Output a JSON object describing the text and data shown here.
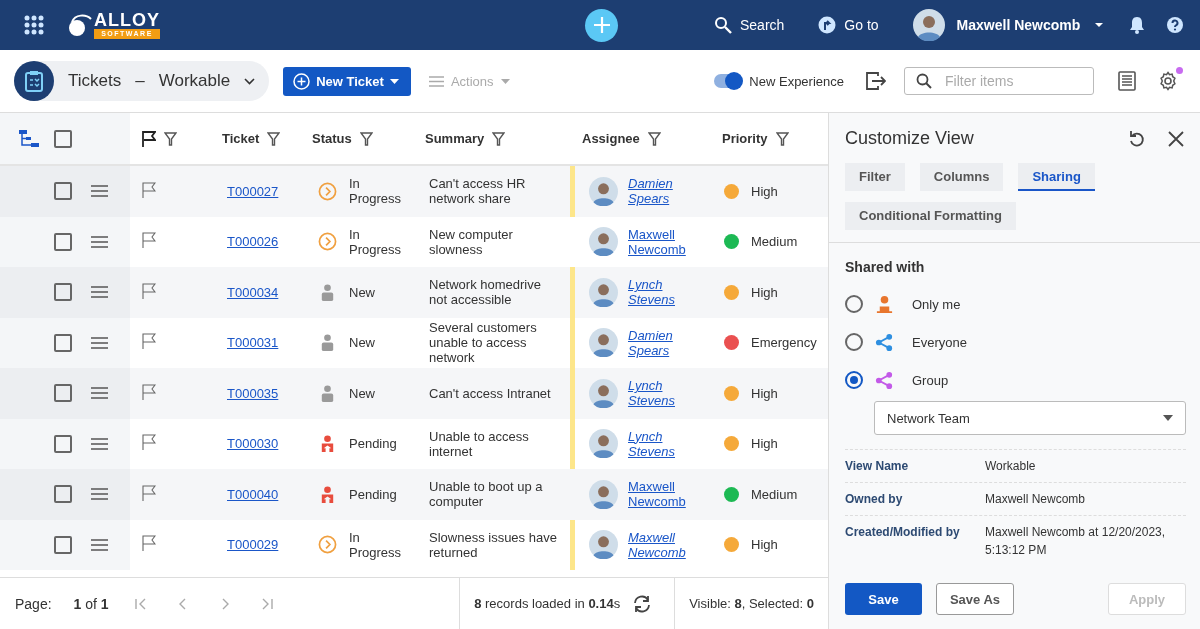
{
  "topbar": {
    "logo": {
      "name": "ALLOY",
      "tagline": "SOFTWARE"
    },
    "search": "Search",
    "goto": "Go to",
    "user": "Maxwell Newcomb"
  },
  "toolbar": {
    "module": "Tickets",
    "separator": "–",
    "view": "Workable",
    "new_button": "New Ticket",
    "actions": {
      "label": "Actions",
      "disabled": true
    },
    "toggle": {
      "label": "New Experience",
      "on": true
    },
    "filter": {
      "placeholder": "Filter items"
    },
    "settings_notification": true
  },
  "table": {
    "select_all": false,
    "columns": [
      "Ticket",
      "Status",
      "Summary",
      "Assignee",
      "Priority"
    ],
    "rows": [
      {
        "checked": false,
        "ticket": "T000027",
        "status": "In Progress",
        "kind": "in_progress",
        "summary": "Can't access HR network share",
        "assignee": "Damien Spears",
        "highlighted": true,
        "priority": "High",
        "color": "#f5a93a"
      },
      {
        "checked": false,
        "ticket": "T000026",
        "status": "In Progress",
        "kind": "in_progress",
        "summary": "New computer slowness",
        "assignee": "Maxwell Newcomb",
        "highlighted": false,
        "priority": "Medium",
        "color": "#1db954"
      },
      {
        "checked": false,
        "ticket": "T000034",
        "status": "New",
        "kind": "new",
        "summary": "Network homedrive not accessible",
        "assignee": "Lynch Stevens",
        "highlighted": true,
        "priority": "High",
        "color": "#f5a93a"
      },
      {
        "checked": false,
        "ticket": "T000031",
        "status": "New",
        "kind": "new",
        "summary": "Several customers unable to access network",
        "assignee": "Damien Spears",
        "highlighted": true,
        "priority": "Emergency",
        "color": "#ea5050"
      },
      {
        "checked": false,
        "ticket": "T000035",
        "status": "New",
        "kind": "new",
        "summary": "Can't access Intranet",
        "assignee": "Lynch Stevens",
        "highlighted": true,
        "priority": "High",
        "color": "#f5a93a"
      },
      {
        "checked": false,
        "ticket": "T000030",
        "status": "Pending",
        "kind": "pending",
        "summary": "Unable to access internet",
        "assignee": "Lynch Stevens",
        "highlighted": true,
        "priority": "High",
        "color": "#f5a93a"
      },
      {
        "checked": false,
        "ticket": "T000040",
        "status": "Pending",
        "kind": "pending",
        "summary": "Unable to boot up a computer",
        "assignee": "Maxwell Newcomb",
        "highlighted": false,
        "priority": "Medium",
        "color": "#1db954"
      },
      {
        "checked": false,
        "ticket": "T000029",
        "status": "In Progress",
        "kind": "in_progress",
        "summary": "Slowness issues have returned",
        "assignee": "Maxwell Newcomb",
        "highlighted": true,
        "priority": "High",
        "color": "#f5a93a"
      }
    ]
  },
  "footer": {
    "page_label": "Page:",
    "page": "**1** of **1**",
    "records": "**8** records loaded in **0.14**s",
    "counts": "Visible: **8**, Selected: **0**"
  },
  "panel": {
    "title": "Customize View",
    "tabs": [
      {
        "label": "Filter",
        "selected": false
      },
      {
        "label": "Columns",
        "selected": false
      },
      {
        "label": "Sharing",
        "selected": true
      },
      {
        "label": "Conditional Formatting",
        "selected": false
      }
    ],
    "shared_with": "Shared with",
    "options": [
      {
        "label": "Only me",
        "kind": "me",
        "selected": false
      },
      {
        "label": "Everyone",
        "kind": "everyone",
        "selected": false
      },
      {
        "label": "Group",
        "kind": "group",
        "selected": true
      }
    ],
    "group": "Network Team",
    "details": [
      {
        "label": "View Name",
        "value": "Workable"
      },
      {
        "label": "Owned by",
        "value": "Maxwell Newcomb"
      },
      {
        "label": "Created/Modified by",
        "value": "Maxwell Newcomb at 12/20/2023, 5:13:12 PM"
      }
    ],
    "buttons": [
      {
        "label": "Save",
        "kind": "primary",
        "disabled": false
      },
      {
        "label": "Save As",
        "kind": "outline",
        "disabled": false
      },
      {
        "label": "Apply",
        "kind": "outline",
        "disabled": true
      }
    ]
  }
}
